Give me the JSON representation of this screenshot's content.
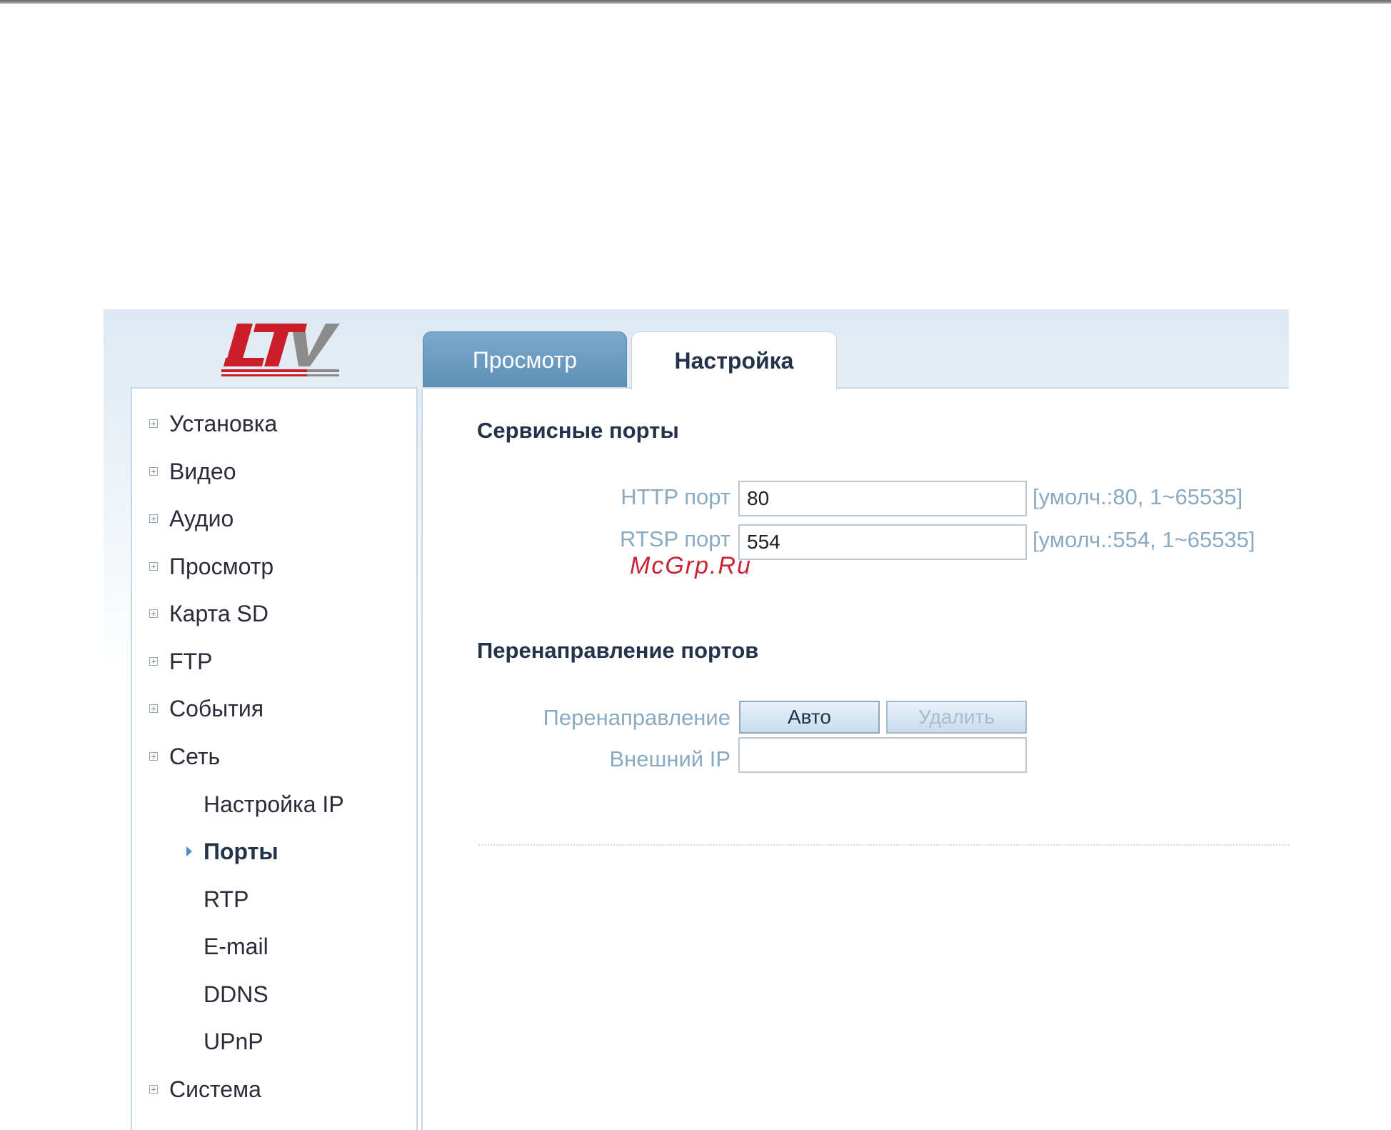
{
  "logo": {
    "text": "LTV",
    "colors": {
      "red": "#cc1e2a",
      "gray": "#8b8b8b"
    }
  },
  "tabs": [
    {
      "label": "Просмотр",
      "active": false
    },
    {
      "label": "Настройка",
      "active": true
    }
  ],
  "sidebar": {
    "items": [
      {
        "label": "Установка",
        "expandable": true
      },
      {
        "label": "Видео",
        "expandable": true
      },
      {
        "label": "Аудио",
        "expandable": true
      },
      {
        "label": "Просмотр",
        "expandable": true
      },
      {
        "label": "Карта SD",
        "expandable": true
      },
      {
        "label": "FTP",
        "expandable": true
      },
      {
        "label": "События",
        "expandable": true
      },
      {
        "label": "Сеть",
        "expandable": true
      }
    ],
    "network_subitems": [
      {
        "label": "Настройка IP"
      },
      {
        "label": "Порты",
        "active": true
      },
      {
        "label": "RTP"
      },
      {
        "label": "E-mail"
      },
      {
        "label": "DDNS"
      },
      {
        "label": "UPnP"
      }
    ],
    "last_item": {
      "label": "Система",
      "expandable": true
    }
  },
  "service_ports": {
    "title": "Сервисные порты",
    "http": {
      "label": "HTTP порт",
      "value": "80",
      "hint": "[умолч.:80, 1~65535]"
    },
    "rtsp": {
      "label": "RTSP порт",
      "value": "554",
      "hint": "[умолч.:554, 1~65535]"
    }
  },
  "port_forwarding": {
    "title": "Перенаправление портов",
    "redirect_label": "Перенаправление",
    "auto_button": "Авто",
    "delete_button": "Удалить",
    "external_ip_label": "Внешний IP",
    "external_ip_value": ""
  },
  "watermark": "McGrp.Ru"
}
